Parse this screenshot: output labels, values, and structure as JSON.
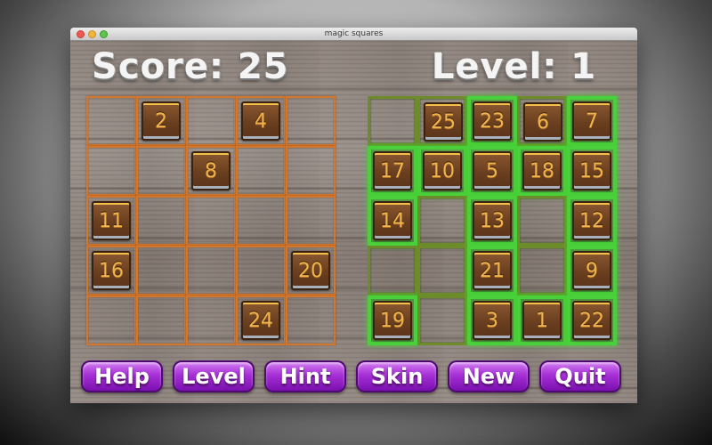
{
  "window": {
    "title": "magic squares"
  },
  "hud": {
    "score": "Score: 25",
    "level": "Level: 1"
  },
  "left_board": {
    "rows": [
      [
        "",
        "2",
        "",
        "4",
        ""
      ],
      [
        "",
        "",
        "8",
        "",
        ""
      ],
      [
        "11",
        "",
        "",
        "",
        ""
      ],
      [
        "16",
        "",
        "",
        "",
        "20"
      ],
      [
        "",
        "",
        "",
        "24",
        ""
      ]
    ]
  },
  "right_board": {
    "rows": [
      [
        "",
        "25",
        "23",
        "6",
        "7"
      ],
      [
        "17",
        "10",
        "5",
        "18",
        "15"
      ],
      [
        "14",
        "",
        "13",
        "",
        "12"
      ],
      [
        "",
        "",
        "21",
        "",
        "9"
      ],
      [
        "19",
        "",
        "3",
        "1",
        "22"
      ]
    ],
    "lit": [
      [
        false,
        false,
        true,
        false,
        true
      ],
      [
        true,
        true,
        true,
        true,
        true
      ],
      [
        true,
        false,
        true,
        false,
        true
      ],
      [
        false,
        false,
        true,
        false,
        true
      ],
      [
        true,
        false,
        true,
        true,
        true
      ]
    ]
  },
  "buttons": [
    {
      "id": "help",
      "label": "Help"
    },
    {
      "id": "level",
      "label": "Level"
    },
    {
      "id": "hint",
      "label": "Hint"
    },
    {
      "id": "skin",
      "label": "Skin"
    },
    {
      "id": "new",
      "label": "New"
    },
    {
      "id": "quit",
      "label": "Quit"
    }
  ],
  "colors": {
    "left_grid": "#d2782e",
    "right_grid": "#6c8c2a",
    "right_grid_lit": "#4ad03a",
    "button": "#a630d6",
    "tile": "#6a3f1f",
    "tile_text": "#f0b44e"
  }
}
